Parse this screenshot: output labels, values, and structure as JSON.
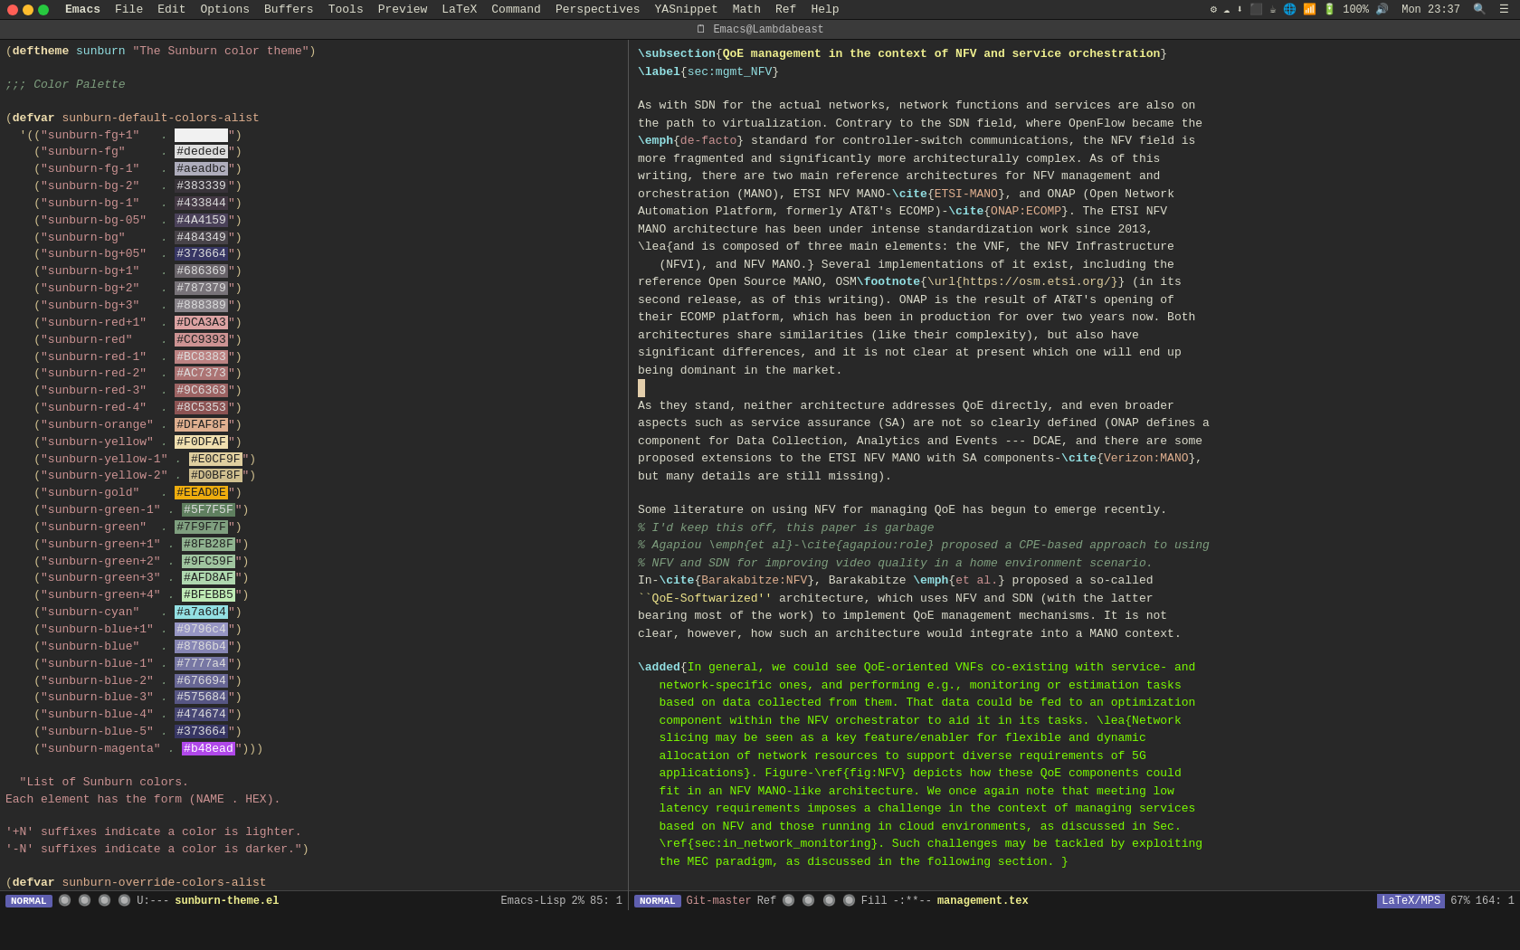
{
  "menubar": {
    "app": "Emacs",
    "items": [
      "File",
      "Edit",
      "Options",
      "Buffers",
      "Tools",
      "Preview",
      "LaTeX",
      "Command",
      "Perspectives",
      "YASnippet",
      "Math",
      "Ref",
      "Help"
    ],
    "time": "Mon 23:37"
  },
  "titlebar": {
    "text": "Emacs@Lambdabeast"
  },
  "left_pane": {
    "filename": "sunburn-theme.el",
    "mode": "Emacs-Lisp",
    "line": "85",
    "col": "1",
    "mode_label": "NORMAL"
  },
  "right_pane": {
    "filename": "management.tex",
    "mode": "LaTeX/MPS",
    "percent": "67%",
    "line": "164",
    "col": "1",
    "mode_label": "NORMAL",
    "git_branch": "Git-master",
    "ref": "Ref",
    "fill": "Fill"
  }
}
